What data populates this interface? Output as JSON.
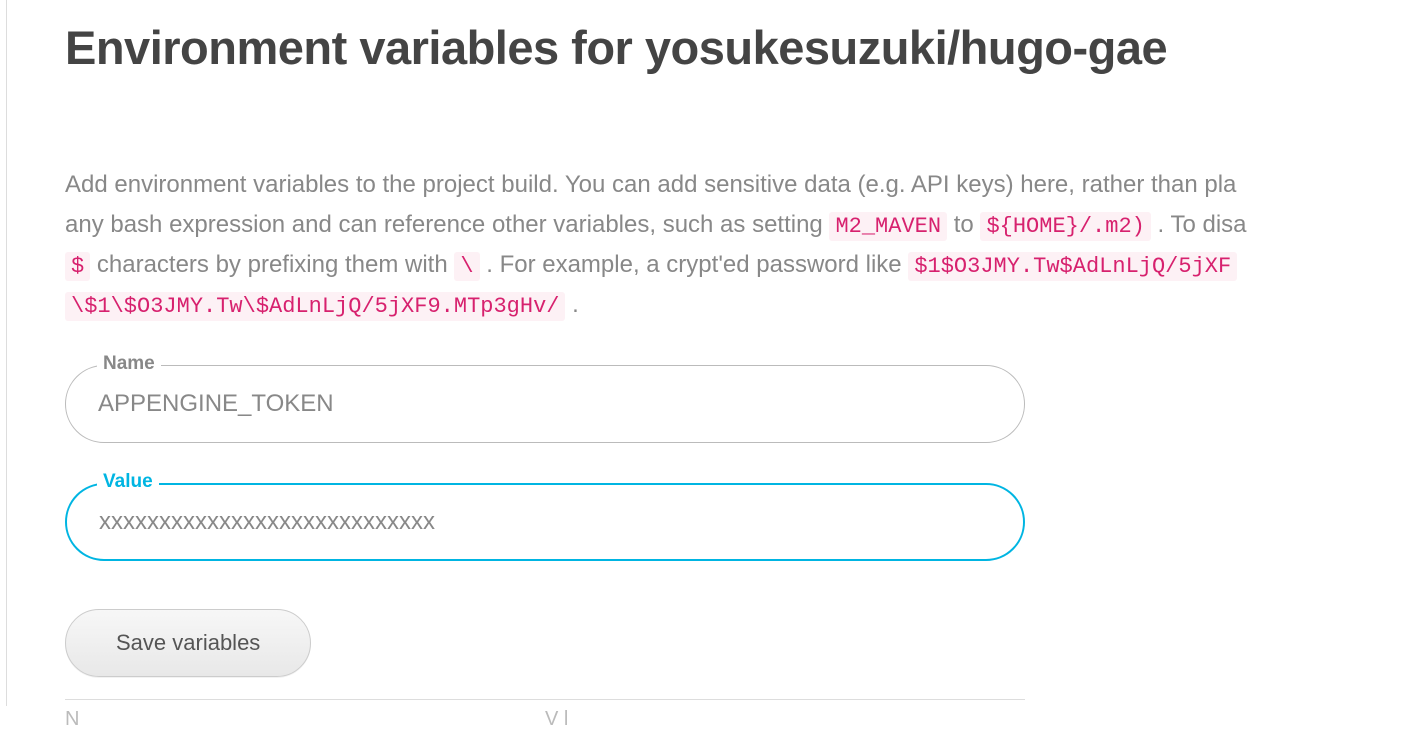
{
  "title": "Environment variables for yosukesuzuki/hugo-gae",
  "description": {
    "t0": "Add environment variables to the project build. You can add sensitive data (e.g. API keys) here, rather than pla",
    "t1": "any bash expression and can reference other variables, such as setting ",
    "c1": "M2_MAVEN",
    "t2": " to ",
    "c2": "${HOME}/.m2)",
    "t3": " . To disa",
    "c3": "$",
    "t4": " characters by prefixing them with ",
    "c4": "\\",
    "t5": " . For example, a crypt'ed password like ",
    "c5": "$1$O3JMY.Tw$AdLnLjQ/5jXF",
    "c6": "\\$1\\$O3JMY.Tw\\$AdLnLjQ/5jXF9.MTp3gHv/",
    "t6": " ."
  },
  "fields": {
    "name_label": "Name",
    "name_value": "APPENGINE_TOKEN",
    "value_label": "Value",
    "value_value": "xxxxxxxxxxxxxxxxxxxxxxxxxxxx"
  },
  "buttons": {
    "save": "Save variables"
  },
  "table": {
    "col1": "N",
    "col2": "V l"
  }
}
